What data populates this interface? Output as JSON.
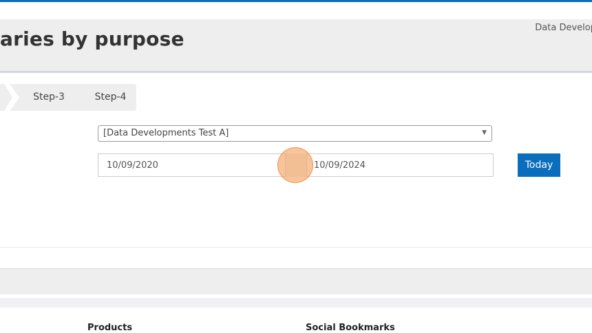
{
  "header": {
    "page_title": "aries by purpose",
    "org_name": "Data Develop"
  },
  "stepper": {
    "steps": [
      {
        "label": ""
      },
      {
        "label": "Step-3"
      },
      {
        "label": "Step-4"
      }
    ]
  },
  "form": {
    "dataset_select": {
      "selected": "[Data Developments Test A]"
    },
    "date_range": {
      "start": "10/09/2020",
      "end": "10/09/2024"
    },
    "today_label": "Today"
  },
  "footer": {
    "headings": [
      "Products",
      "Social Bookmarks"
    ]
  },
  "colors": {
    "accent": "#0a6ebd",
    "header_bg": "#efeeef",
    "click_marker": "#f5a664"
  }
}
